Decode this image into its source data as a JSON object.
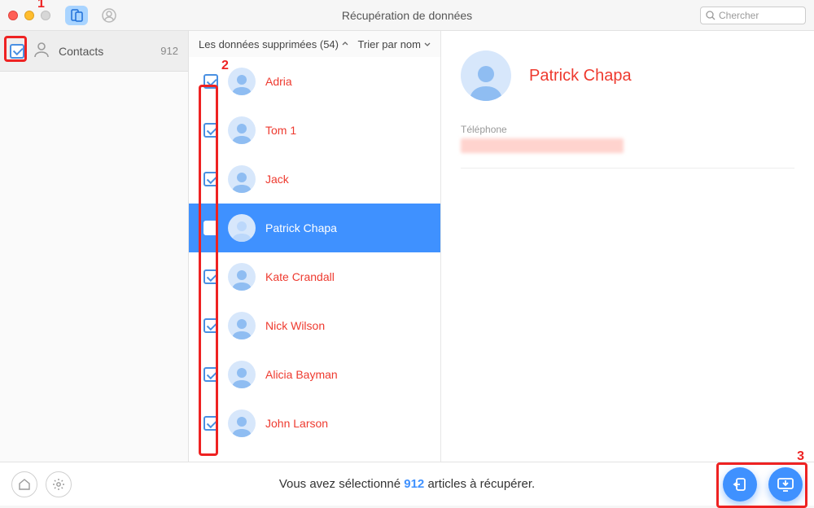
{
  "window": {
    "title": "Récupération de données",
    "search_placeholder": "Chercher"
  },
  "sidebar": {
    "items": [
      {
        "label": "Contacts",
        "count": "912",
        "checked": true
      }
    ]
  },
  "list": {
    "filter_label": "Les données supprimées (54)",
    "sort_label": "Trier par nom",
    "contacts": [
      {
        "name": "Adria",
        "checked": true,
        "selected": false
      },
      {
        "name": "Tom 1",
        "checked": true,
        "selected": false
      },
      {
        "name": "Jack",
        "checked": true,
        "selected": false
      },
      {
        "name": "Patrick Chapa",
        "checked": true,
        "selected": true
      },
      {
        "name": "Kate Crandall",
        "checked": true,
        "selected": false
      },
      {
        "name": "Nick Wilson",
        "checked": true,
        "selected": false
      },
      {
        "name": "Alicia Bayman",
        "checked": true,
        "selected": false
      },
      {
        "name": "John Larson",
        "checked": true,
        "selected": false
      }
    ]
  },
  "detail": {
    "name": "Patrick Chapa",
    "phone_label": "Téléphone"
  },
  "bottom": {
    "status_prefix": "Vous avez sélectionné ",
    "status_count": "912",
    "status_suffix": " articles à récupérer."
  },
  "annotations": {
    "num1": "1",
    "num2": "2",
    "num3": "3"
  }
}
